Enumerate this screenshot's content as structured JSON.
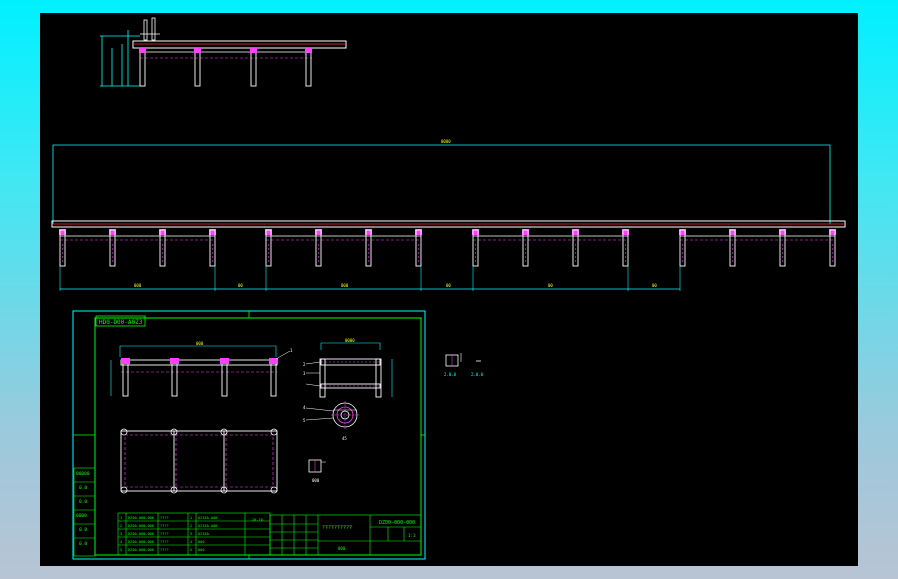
{
  "drawing": {
    "part_number": "HD0-D00-A0Z3",
    "span_labels": [
      "000",
      "00",
      "000",
      "00",
      "00",
      "00"
    ],
    "top_dimension": "0000",
    "detail_dimension": "000",
    "side_dimension": "0000",
    "hole_label": "45",
    "small_label": "000",
    "right_label_a": "2.0.0",
    "right_label_b": "2.0.0",
    "leader_labels": [
      "1",
      "2",
      "3",
      "4",
      "5"
    ],
    "vertical_dims": [
      "00",
      "00",
      "00"
    ]
  },
  "title_block": {
    "drawing_no": "DZ00-000-000",
    "name": "??????????",
    "scale": "1:1",
    "material": "000",
    "date": "20-70",
    "bom_rows": [
      {
        "no": "1",
        "code": "DZ00-000-000",
        "name": "????",
        "qty": "1",
        "mat": "Q235A-A00"
      },
      {
        "no": "2",
        "code": "DZ00-000-000",
        "name": "????",
        "qty": "2",
        "mat": "Q235A-A00"
      },
      {
        "no": "3",
        "code": "DZ00-000-000",
        "name": "????",
        "qty": "3",
        "mat": "Q235A"
      },
      {
        "no": "4",
        "code": "DZ00-000-000",
        "name": "????",
        "qty": "4",
        "mat": "000"
      },
      {
        "no": "5",
        "code": "DZ00-000-000",
        "name": "????",
        "qty": "5",
        "mat": "000"
      }
    ],
    "left_strip": [
      "00000",
      "0.0",
      "0.0",
      "0000",
      "0.0",
      "0.0"
    ]
  }
}
